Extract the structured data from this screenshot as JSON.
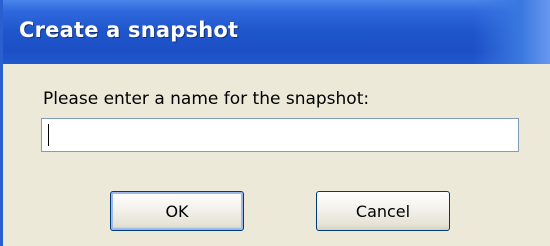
{
  "dialog": {
    "title": "Create a snapshot",
    "prompt": "Please enter a name for the snapshot:",
    "name_value": "",
    "ok_label": "OK",
    "cancel_label": "Cancel"
  },
  "colors": {
    "titlebar": "#1f55cc",
    "body": "#ece9d8",
    "button_border": "#003c74"
  }
}
